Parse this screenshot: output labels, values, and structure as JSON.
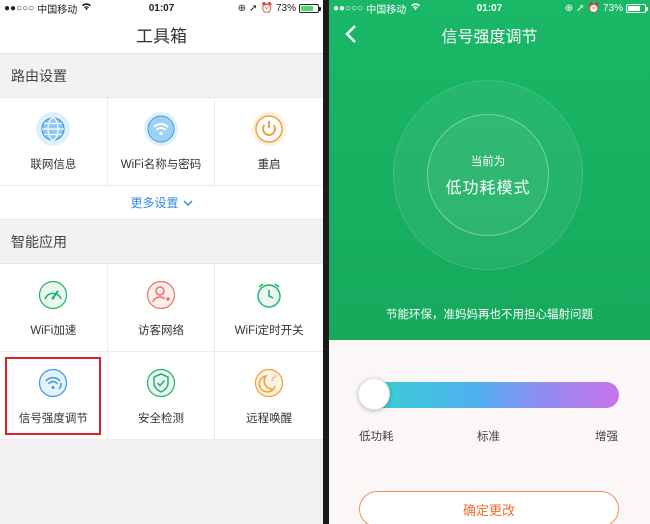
{
  "left": {
    "status": {
      "carrier": "中国移动",
      "time": "01:07",
      "battery": "73%"
    },
    "title": "工具箱",
    "router_section": {
      "title": "路由设置",
      "items": [
        {
          "label": "联网信息",
          "icon": "globe-icon",
          "color": "#3a9be0"
        },
        {
          "label": "WiFi名称与密码",
          "icon": "wifi-icon",
          "color": "#3a9be0"
        },
        {
          "label": "重启",
          "icon": "power-icon",
          "color": "#f2a13a"
        }
      ],
      "more": "更多设置"
    },
    "apps_section": {
      "title": "智能应用",
      "items": [
        {
          "label": "WiFi加速",
          "icon": "speedometer-icon",
          "color": "#25b26b"
        },
        {
          "label": "访客网络",
          "icon": "guest-user-icon",
          "color": "#e9716a"
        },
        {
          "label": "WiFi定时开关",
          "icon": "alarm-clock-icon",
          "color": "#25b26b"
        },
        {
          "label": "信号强度调节",
          "icon": "signal-strength-icon",
          "color": "#3a9be0"
        },
        {
          "label": "安全检测",
          "icon": "shield-check-icon",
          "color": "#25b26b"
        },
        {
          "label": "远程唤醒",
          "icon": "moon-sleep-icon",
          "color": "#f2a13a"
        }
      ]
    }
  },
  "right": {
    "status": {
      "carrier": "中国移动",
      "time": "01:07",
      "battery": "73%"
    },
    "title": "信号强度调节",
    "current_label": "当前为",
    "current_mode": "低功耗模式",
    "tip": "节能环保，准妈妈再也不用担心辐射问题",
    "slider": {
      "labels": [
        "低功耗",
        "标准",
        "增强"
      ],
      "value_index": 0
    },
    "confirm": "确定更改"
  }
}
